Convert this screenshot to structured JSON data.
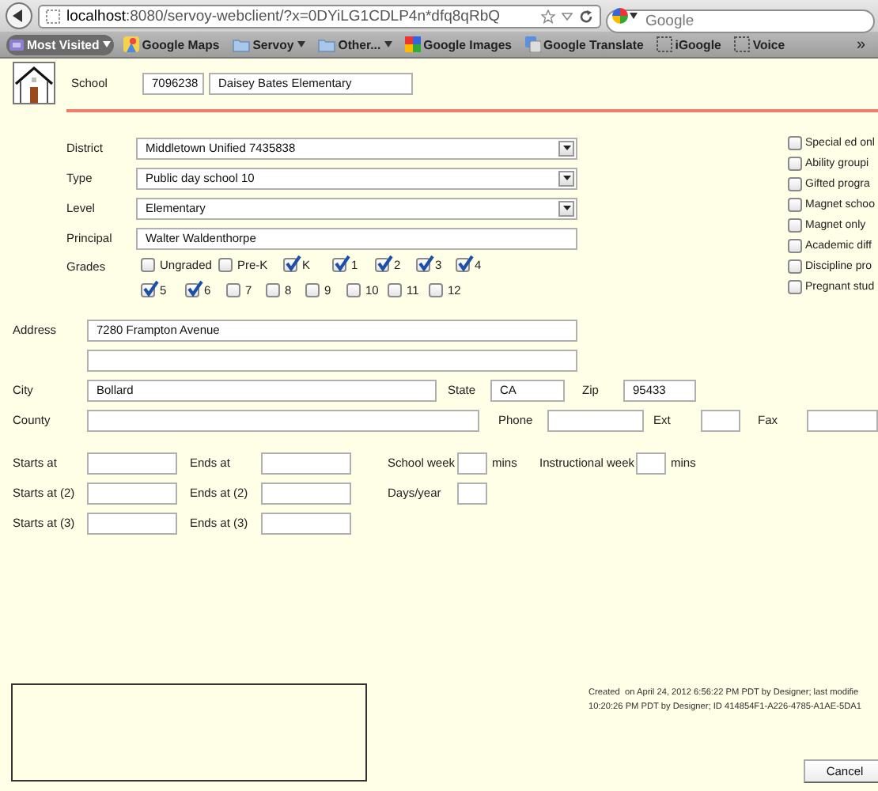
{
  "browser": {
    "url_host": "localhost",
    "url_rest": ":8080/servoy-webclient/?x=0DYiLG1CDLP4n*dfq8qRbQ",
    "search_placeholder": "Google"
  },
  "bookmarks": [
    {
      "label": "Most Visited",
      "kind": "menu"
    },
    {
      "label": "Google Maps",
      "kind": "maps"
    },
    {
      "label": "Servoy",
      "kind": "folder"
    },
    {
      "label": "Other...",
      "kind": "folder"
    },
    {
      "label": "Google Images",
      "kind": "google"
    },
    {
      "label": "Google Translate",
      "kind": "translate"
    },
    {
      "label": "iGoogle",
      "kind": "page"
    },
    {
      "label": "Voice",
      "kind": "page"
    }
  ],
  "bookmarks_overflow": "»",
  "school": {
    "label": "School",
    "code": "7096238",
    "name": "Daisey Bates Elementary"
  },
  "details": [
    {
      "label": "District",
      "kind": "select",
      "value": "Middletown Unified 7435838"
    },
    {
      "label": "Type",
      "kind": "select",
      "value": "Public day school 10"
    },
    {
      "label": "Level",
      "kind": "select",
      "value": "Elementary"
    },
    {
      "label": "Principal",
      "kind": "text",
      "value": "Walter Waldenthorpe"
    }
  ],
  "grades": {
    "label": "Grades",
    "options": [
      {
        "label": "Ungraded",
        "checked": false
      },
      {
        "label": "Pre-K",
        "checked": false
      },
      {
        "label": "K",
        "checked": true
      },
      {
        "label": "1",
        "checked": true
      },
      {
        "label": "2",
        "checked": true
      },
      {
        "label": "3",
        "checked": true
      },
      {
        "label": "4",
        "checked": true
      },
      {
        "label": "5",
        "checked": true
      },
      {
        "label": "6",
        "checked": true
      },
      {
        "label": "7",
        "checked": false
      },
      {
        "label": "8",
        "checked": false
      },
      {
        "label": "9",
        "checked": false
      },
      {
        "label": "10",
        "checked": false
      },
      {
        "label": "11",
        "checked": false
      },
      {
        "label": "12",
        "checked": false
      }
    ]
  },
  "flags": [
    {
      "label": "Special ed onl",
      "checked": false
    },
    {
      "label": "Ability groupi",
      "checked": false
    },
    {
      "label": "Gifted progra",
      "checked": false
    },
    {
      "label": "Magnet schoo",
      "checked": false
    },
    {
      "label": "Magnet only",
      "checked": false
    },
    {
      "label": "Academic diff",
      "checked": false
    },
    {
      "label": "Discipline pro",
      "checked": false
    },
    {
      "label": "Pregnant stud",
      "checked": false
    }
  ],
  "contact_rows": [
    [
      {
        "kind": "label",
        "text": "Address"
      },
      {
        "kind": "field",
        "value": "7280 Frampton Avenue"
      }
    ],
    [
      {
        "kind": "spacer"
      },
      {
        "kind": "field"
      }
    ],
    [
      {
        "kind": "label",
        "text": "City"
      },
      {
        "kind": "field",
        "value": "Bollard"
      },
      {
        "kind": "label",
        "text": "State"
      },
      {
        "kind": "field",
        "value": "CA"
      },
      {
        "kind": "label",
        "text": "Zip"
      },
      {
        "kind": "field",
        "value": "95433"
      }
    ],
    [
      {
        "kind": "label",
        "text": "County"
      },
      {
        "kind": "field"
      },
      {
        "kind": "label",
        "text": "Phone"
      },
      {
        "kind": "field"
      },
      {
        "kind": "label",
        "text": "Ext"
      },
      {
        "kind": "field"
      },
      {
        "kind": "label",
        "text": "Fax"
      },
      {
        "kind": "field"
      }
    ]
  ],
  "time_rows": [
    [
      {
        "kind": "label",
        "text": "Starts at"
      },
      {
        "kind": "field"
      },
      {
        "kind": "label",
        "text": "Ends at"
      },
      {
        "kind": "field"
      },
      {
        "kind": "label",
        "text": "School week"
      },
      {
        "kind": "field"
      },
      {
        "kind": "label",
        "text": "mins"
      },
      {
        "kind": "label",
        "text": "Instructional week"
      },
      {
        "kind": "field"
      },
      {
        "kind": "label",
        "text": "mins"
      }
    ],
    [
      {
        "kind": "label",
        "text": "Starts at (2)"
      },
      {
        "kind": "field"
      },
      {
        "kind": "label",
        "text": "Ends at (2)"
      },
      {
        "kind": "field"
      },
      {
        "kind": "label",
        "text": "Days/year"
      },
      {
        "kind": "field"
      }
    ],
    [
      {
        "kind": "label",
        "text": "Starts at (3)"
      },
      {
        "kind": "field"
      },
      {
        "kind": "label",
        "text": "Ends at (3)"
      },
      {
        "kind": "field"
      }
    ]
  ],
  "footer": {
    "audit": [
      "Created  on April 24, 2012 6:56:22 PM PDT by Designer; last modifie",
      "10:20:26 PM PDT by Designer; ID 414854F1-A226-4785-A1AE-5DA1"
    ],
    "cancel": "Cancel"
  }
}
